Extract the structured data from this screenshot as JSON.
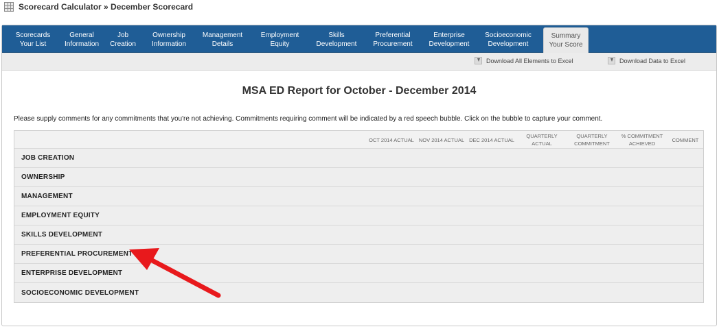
{
  "breadcrumb": "Scorecard Calculator » December Scorecard",
  "nav_tabs": [
    {
      "label": "Scorecards\nYour List"
    },
    {
      "label": "General\nInformation"
    },
    {
      "label": "Job\nCreation"
    },
    {
      "label": "Ownership\nInformation"
    },
    {
      "label": "Management\nDetails"
    },
    {
      "label": "Employment\nEquity"
    },
    {
      "label": "Skills\nDevelopment"
    },
    {
      "label": "Preferential\nProcurement"
    },
    {
      "label": "Enterprise\nDevelopment"
    },
    {
      "label": "Socioeconomic\nDevelopment"
    },
    {
      "label": "Summary\nYour Score"
    }
  ],
  "active_tab": "Summary\nYour Score",
  "toolbar": {
    "download_all": "Download All Elements to Excel",
    "download_data": "Download Data to Excel"
  },
  "report_title": "MSA ED Report for October - December 2014",
  "instructions": "Please supply comments for any commitments that you're not achieving. Commitments requiring comment will be indicated by a red speech bubble. Click on the bubble to capture your comment.",
  "table": {
    "columns": [
      "OCT 2014 ACTUAL",
      "NOV 2014 ACTUAL",
      "DEC 2014 ACTUAL",
      "QUARTERLY\nACTUAL",
      "QUARTERLY\nCOMMITMENT",
      "% COMMITMENT\nACHIEVED",
      "COMMENT"
    ],
    "rows": [
      "JOB CREATION",
      "OWNERSHIP",
      "MANAGEMENT",
      "EMPLOYMENT EQUITY",
      "SKILLS DEVELOPMENT",
      "PREFERENTIAL PROCUREMENT",
      "ENTERPRISE DEVELOPMENT",
      "SOCIOECONOMIC DEVELOPMENT"
    ]
  },
  "colors": {
    "nav_bg": "#1f5d96",
    "annotation_arrow": "#e8191c"
  }
}
